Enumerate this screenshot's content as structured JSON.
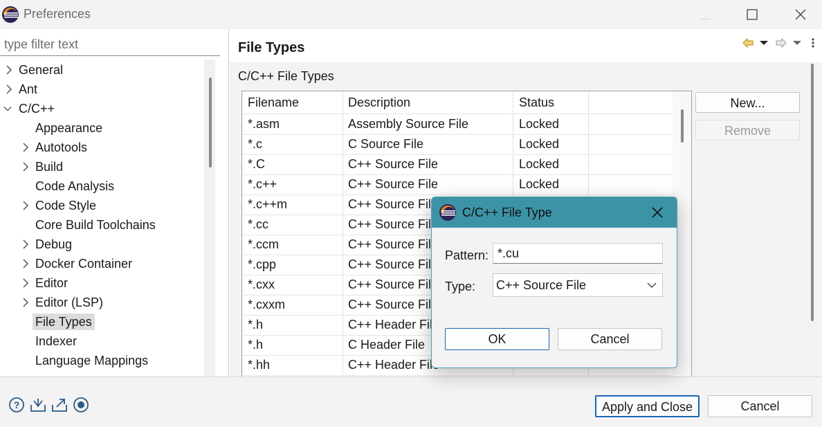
{
  "window": {
    "title": "Preferences",
    "controls": [
      "minimize-icon",
      "maximize-icon",
      "close-icon"
    ]
  },
  "sidebar": {
    "filter_placeholder": "type filter text",
    "items": [
      {
        "label": "General",
        "level": 0,
        "expandable": true,
        "expanded": false
      },
      {
        "label": "Ant",
        "level": 0,
        "expandable": true,
        "expanded": false
      },
      {
        "label": "C/C++",
        "level": 0,
        "expandable": true,
        "expanded": true
      },
      {
        "label": "Appearance",
        "level": 1,
        "expandable": false
      },
      {
        "label": "Autotools",
        "level": 1,
        "expandable": true
      },
      {
        "label": "Build",
        "level": 1,
        "expandable": true
      },
      {
        "label": "Code Analysis",
        "level": 1,
        "expandable": false
      },
      {
        "label": "Code Style",
        "level": 1,
        "expandable": true
      },
      {
        "label": "Core Build Toolchains",
        "level": 1,
        "expandable": false
      },
      {
        "label": "Debug",
        "level": 1,
        "expandable": true
      },
      {
        "label": "Docker Container",
        "level": 1,
        "expandable": true
      },
      {
        "label": "Editor",
        "level": 1,
        "expandable": true
      },
      {
        "label": "Editor (LSP)",
        "level": 1,
        "expandable": true
      },
      {
        "label": "File Types",
        "level": 1,
        "expandable": false,
        "selected": true
      },
      {
        "label": "Indexer",
        "level": 1,
        "expandable": false
      },
      {
        "label": "Language Mappings",
        "level": 1,
        "expandable": false
      }
    ]
  },
  "page": {
    "title": "File Types",
    "section_label": "C/C++ File Types",
    "nav_icons": [
      "back-arrow-icon",
      "back-menu-icon",
      "forward-arrow-icon",
      "forward-menu-icon",
      "view-menu-icon"
    ]
  },
  "table": {
    "columns": [
      "Filename",
      "Description",
      "Status"
    ],
    "rows": [
      [
        "*.asm",
        "Assembly Source File",
        "Locked"
      ],
      [
        "*.c",
        "C Source File",
        "Locked"
      ],
      [
        "*.C",
        "C++ Source File",
        "Locked"
      ],
      [
        "*.c++",
        "C++ Source File",
        "Locked"
      ],
      [
        "*.c++m",
        "C++ Source File",
        ""
      ],
      [
        "*.cc",
        "C++ Source File",
        ""
      ],
      [
        "*.ccm",
        "C++ Source File",
        ""
      ],
      [
        "*.cpp",
        "C++ Source File",
        ""
      ],
      [
        "*.cxx",
        "C++ Source File",
        ""
      ],
      [
        "*.cxxm",
        "C++ Source File",
        ""
      ],
      [
        "*.h",
        "C++ Header File",
        ""
      ],
      [
        "*.h",
        "C Header File",
        ""
      ],
      [
        "*.hh",
        "C++ Header File",
        ""
      ]
    ]
  },
  "buttons": {
    "new": "New...",
    "remove": "Remove",
    "apply_close": "Apply and Close",
    "cancel": "Cancel"
  },
  "bottom_icons": [
    "help-icon",
    "import-icon",
    "export-icon",
    "record-icon"
  ],
  "dialog": {
    "title": "C/C++ File Type",
    "pattern_label": "Pattern:",
    "pattern_value": "*.cu",
    "type_label": "Type:",
    "type_value": "C++ Source File",
    "ok": "OK",
    "cancel": "Cancel"
  },
  "colors": {
    "dialog_titlebar": "#3d93a6",
    "dialog_border": "#4aa0b5",
    "accent_button_border": "#1a66b3",
    "eclipse_purple": "#2c2255",
    "eclipse_orange": "#f7941e"
  }
}
